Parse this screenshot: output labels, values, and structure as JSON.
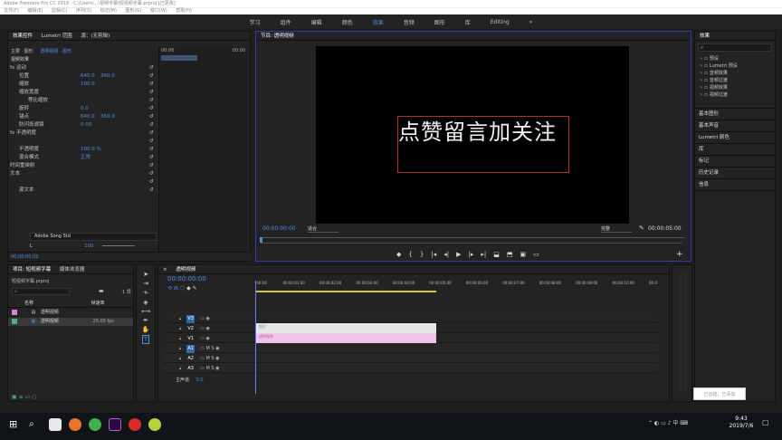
{
  "window": {
    "title": "Adobe Premiere Pro CC 2018 - C:\\Users\\...\\视频字幕\\短视频字幕.prproj [已更改]"
  },
  "menu": [
    "文件(F)",
    "编辑(E)",
    "剪辑(C)",
    "序列(S)",
    "标记(M)",
    "图形(G)",
    "窗口(W)",
    "帮助(H)"
  ],
  "workspaces": [
    {
      "label": "学习",
      "active": false
    },
    {
      "label": "组件",
      "active": false
    },
    {
      "label": "编辑",
      "active": false
    },
    {
      "label": "颜色",
      "active": false
    },
    {
      "label": "效果",
      "active": true
    },
    {
      "label": "音频",
      "active": false
    },
    {
      "label": "图形",
      "active": false
    },
    {
      "label": "库",
      "active": false
    },
    {
      "label": "Editing",
      "active": false
    },
    {
      "label": "»",
      "active": false
    }
  ],
  "effect_controls": {
    "tabs": [
      "效果控件",
      "Lumetri 范围",
      "源：(无剪辑)"
    ],
    "breadcrumb": "主要 · 图形",
    "clip": "透明视频 · 图形",
    "header": "视频效果",
    "timecodes": [
      "00:00",
      "00:00"
    ],
    "rows": [
      {
        "label": "fx  运动",
        "value": "",
        "value2": ""
      },
      {
        "label": "位置",
        "value": "640.0",
        "value2": "360.0"
      },
      {
        "label": "缩放",
        "value": "100.0",
        "value2": ""
      },
      {
        "label": "缩放宽度",
        "value": "",
        "value2": ""
      },
      {
        "label": "等比缩放",
        "value": "",
        "value2": ""
      },
      {
        "label": "旋转",
        "value": "0.0",
        "value2": ""
      },
      {
        "label": "锚点",
        "value": "640.0",
        "value2": "360.0"
      },
      {
        "label": "防闪烁滤镜",
        "value": "0.00",
        "value2": ""
      },
      {
        "label": "fx  不透明度",
        "value": "",
        "value2": ""
      },
      {
        "label": "",
        "value": "",
        "value2": ""
      },
      {
        "label": "不透明度",
        "value": "100.0 %",
        "value2": ""
      },
      {
        "label": "混合模式",
        "value": "正常",
        "value2": ""
      },
      {
        "label": "时间重映射",
        "value": "",
        "value2": ""
      },
      {
        "label": "文本",
        "value": "",
        "value2": ""
      },
      {
        "label": "",
        "value": "",
        "value2": ""
      },
      {
        "label": "源文本",
        "value": "",
        "value2": ""
      }
    ],
    "font": "Adobe Song Std",
    "font_style": "L",
    "font_size": "100",
    "tracking": "400",
    "tracking2": "0",
    "kerning": "0",
    "kerning2": "0",
    "current_time": "00:00:00:00"
  },
  "program": {
    "title": "节目: 透明视频",
    "overlay_text": "点赞留言加关注",
    "timecode": "00:00:00:00",
    "fit": "适合",
    "quality": "完整",
    "duration": "00:00:05:00"
  },
  "project": {
    "tabs": [
      "项目: 短视频字幕",
      "媒体浏览器"
    ],
    "file": "短视频字幕.prproj",
    "count": "1 项",
    "columns": [
      "名称",
      "帧速率"
    ],
    "items": [
      {
        "name": "透明视频",
        "rate": "",
        "color": "#e07fd0"
      },
      {
        "name": "透明视频",
        "rate": "25.00 fps",
        "color": "#4fb07a"
      }
    ]
  },
  "timeline": {
    "title": "透明视频",
    "timecode": "00:00:00:00",
    "ruler": [
      ":00:00",
      "00:00:01:00",
      "00:00:02:00",
      "00:00:03:00",
      "00:00:04:00",
      "00:00:05:00",
      "00:00:06:00",
      "00:00:07:00",
      "00:00:08:00",
      "00:00:09:00",
      "00:00:10:00",
      "00:0"
    ],
    "video_tracks": [
      "V3",
      "V2",
      "V1"
    ],
    "audio_tracks": [
      "A1",
      "A2",
      "A3"
    ],
    "master": "主声道",
    "master_value": "0.0",
    "clips": [
      {
        "track": "V2",
        "label": "图形"
      },
      {
        "track": "V1",
        "label": "透明视频"
      }
    ]
  },
  "effects_panel": {
    "title": "效果",
    "tree": [
      "预设",
      "Lumetri 预设",
      "音频效果",
      "音频过渡",
      "视频效果",
      "视频过渡"
    ],
    "sections": [
      "基本图形",
      "基本声音",
      "Lumetri 颜色",
      "库",
      "标记",
      "历史记录",
      "信息"
    ]
  },
  "popup": "已创建，已添加",
  "taskbar": {
    "time": "9:43",
    "date": "2019/7/6"
  },
  "colors": {
    "accent": "#4b8fe0",
    "clip_v2": "#e6e6e6",
    "clip_v1": "#f2c2e8",
    "playhead": "#5b7fff"
  }
}
